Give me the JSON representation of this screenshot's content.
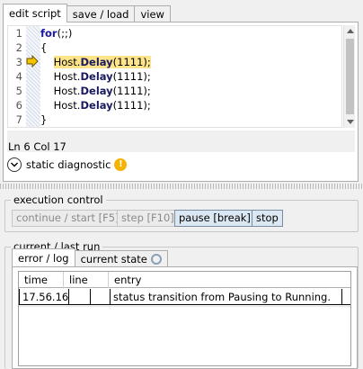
{
  "tabs": [
    "edit script",
    "save / load",
    "view"
  ],
  "editor": {
    "line_numbers": [
      "1",
      "2",
      "3",
      "4",
      "5",
      "6",
      "7"
    ],
    "lines": [
      {
        "kw": "for",
        "rest": "(;;)"
      },
      {
        "text": "{"
      },
      {
        "host": "Host.",
        "method": "Delay",
        "args": "(1111);"
      },
      {
        "host": "Host.",
        "method": "Delay",
        "args": "(1111);"
      },
      {
        "host": "Host.",
        "method": "Delay",
        "args": "(1111);"
      },
      {
        "host": "Host.",
        "method": "Delay",
        "args": "(1111);"
      },
      {
        "text": "}"
      }
    ],
    "current_line_index": 2,
    "caret_status": "Ln 6 Col 17",
    "diagnostic_label": "static diagnostic",
    "warning_glyph": "!"
  },
  "execution": {
    "label": "execution control",
    "buttons": [
      "continue / start [F5]",
      "step [F10]",
      "pause [break]",
      "stop"
    ]
  },
  "run": {
    "label": "current / last run",
    "tabs": [
      "error / log",
      "current state"
    ],
    "columns": [
      "time",
      "line",
      "entry"
    ],
    "rows": [
      {
        "time": "17.56.16",
        "line": "",
        "entry": "status transition from Pausing to Running."
      }
    ]
  },
  "colors": {
    "highlight": "#fde48a",
    "keyword": "#1a1a9f",
    "warning": "#f5b300",
    "active_button": "#dbe7f3"
  }
}
